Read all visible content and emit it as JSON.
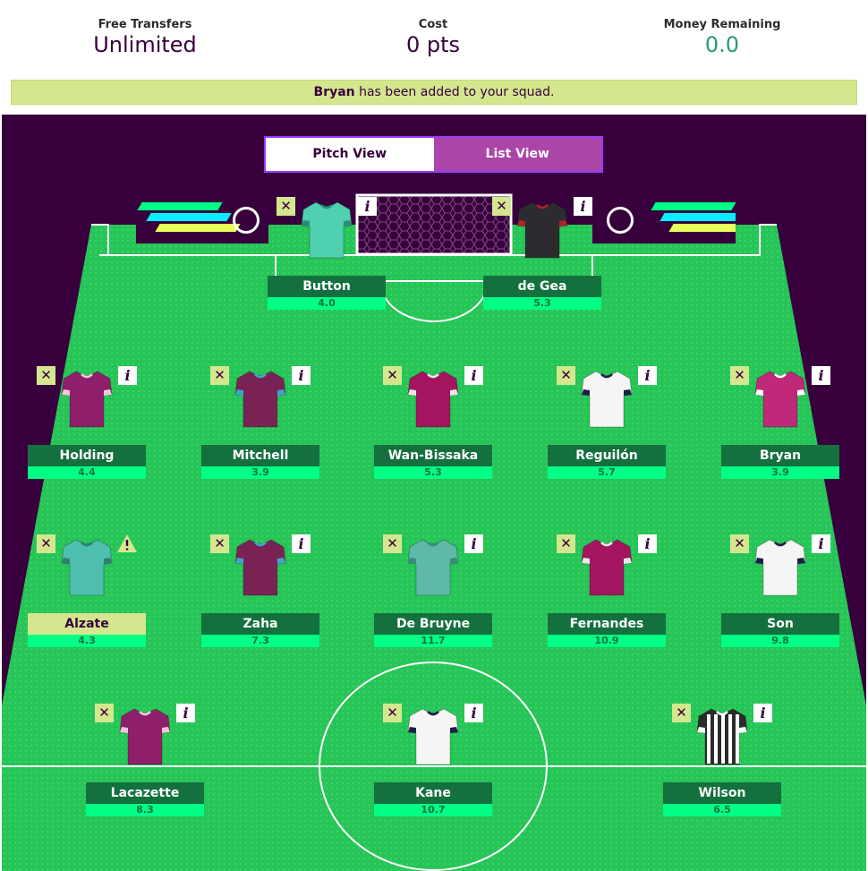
{
  "summary": {
    "free_transfers_label": "Free Transfers",
    "free_transfers_value": "Unlimited",
    "cost_label": "Cost",
    "cost_value": "0 pts",
    "money_label": "Money Remaining",
    "money_value": "0.0"
  },
  "alert": {
    "player": "Bryan",
    "text": " has been added to your squad."
  },
  "view_toggle": {
    "pitch": "Pitch View",
    "list": "List View",
    "active": "list"
  },
  "icons": {
    "remove": "close-icon",
    "info": "info-icon",
    "warning": "warning-icon"
  },
  "colors": {
    "pitch_green": "#25c256",
    "brand_purple": "#37003c",
    "name_bar": "#14703f",
    "price_bar": "#00ff85",
    "alert_bg": "#d4e78f"
  },
  "goalkeepers": [
    {
      "name": "Button",
      "price": "4.0",
      "shirt": "#4fd1b1",
      "trim": "#2a8d79"
    },
    {
      "name": "de Gea",
      "price": "5.3",
      "shirt": "#2c2c30",
      "trim": "#b3202a"
    }
  ],
  "defenders": [
    {
      "name": "Holding",
      "price": "4.4",
      "shirt": "#8e1f6b",
      "trim": "#f1c7d8"
    },
    {
      "name": "Mitchell",
      "price": "3.9",
      "shirt": "#7a2256",
      "trim": "#3fa5c8"
    },
    {
      "name": "Wan-Bissaka",
      "price": "5.3",
      "shirt": "#a4145f",
      "trim": "#e8e8e8"
    },
    {
      "name": "Reguilón",
      "price": "5.7",
      "shirt": "#f5f5f5",
      "trim": "#1b1f4a"
    },
    {
      "name": "Bryan",
      "price": "3.9",
      "shirt": "#c0287a",
      "trim": "#ffffff"
    }
  ],
  "midfielders": [
    {
      "name": "Alzate",
      "price": "4.3",
      "shirt": "#4ebfae",
      "trim": "#2f7d74",
      "warning": true
    },
    {
      "name": "Zaha",
      "price": "7.3",
      "shirt": "#7a2256",
      "trim": "#3fa5c8"
    },
    {
      "name": "De Bruyne",
      "price": "11.7",
      "shirt": "#5fb9a9",
      "trim": "#3b8a80"
    },
    {
      "name": "Fernandes",
      "price": "10.9",
      "shirt": "#a4145f",
      "trim": "#e8e8e8"
    },
    {
      "name": "Son",
      "price": "9.8",
      "shirt": "#f5f5f5",
      "trim": "#1b1f4a"
    }
  ],
  "forwards": [
    {
      "name": "Lacazette",
      "price": "8.3",
      "shirt": "#8e1f6b",
      "trim": "#f1c7d8"
    },
    {
      "name": "Kane",
      "price": "10.7",
      "shirt": "#f5f5f5",
      "trim": "#1b1f4a"
    },
    {
      "name": "Wilson",
      "price": "6.5",
      "shirt": "#2b2b2b",
      "trim": "#ffffff",
      "stripes": true
    }
  ]
}
